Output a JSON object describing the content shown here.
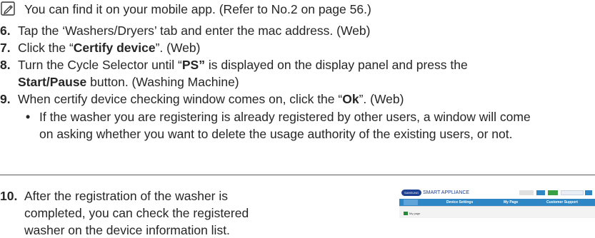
{
  "note": {
    "icon": "note-pencil-icon",
    "text": "You can find it on your mobile app. (Refer to No.2 on page 56.)"
  },
  "steps": {
    "s6": {
      "num": "6.",
      "text": "Tap the ‘Washers/Dryers’ tab and enter the mac address. (Web)"
    },
    "s7": {
      "num": "7.",
      "pre": "Click the “",
      "bold": "Certify device",
      "post": "”. (Web)"
    },
    "s8": {
      "num": "8.",
      "pre": "Turn the Cycle Selector until “",
      "bold": "PS”",
      "post": " is displayed on the display panel and press the",
      "line2_bold": "Start/Pause",
      "line2_post": " button. (Washing Machine)"
    },
    "s9": {
      "num": "9.",
      "pre": "When certify device checking window comes on, click the “",
      "bold": "Ok",
      "post": "”. (Web)"
    },
    "s9_bullet": {
      "mark": "•",
      "line1": "If the washer you are registering is already registered by other users, a window will come",
      "line2": "on asking whether you want to delete the usage authority of the existing users, or not."
    },
    "s10": {
      "num": "10.",
      "line1": "After the registration of the washer is",
      "line2": "completed, you can check the registered",
      "line3": "washer on the device information list."
    }
  },
  "screenshot": {
    "logo": "SAMSUNG",
    "title": "SMART APPLIANCE",
    "nav": [
      "Device Settings",
      "My Page",
      "Customer Support"
    ],
    "body_label": "My page"
  },
  "colors": {
    "text": "#262626",
    "nav_blue": "#2f86c4",
    "logo_blue": "#1d3f8f",
    "divider": "#5a5a5a"
  }
}
